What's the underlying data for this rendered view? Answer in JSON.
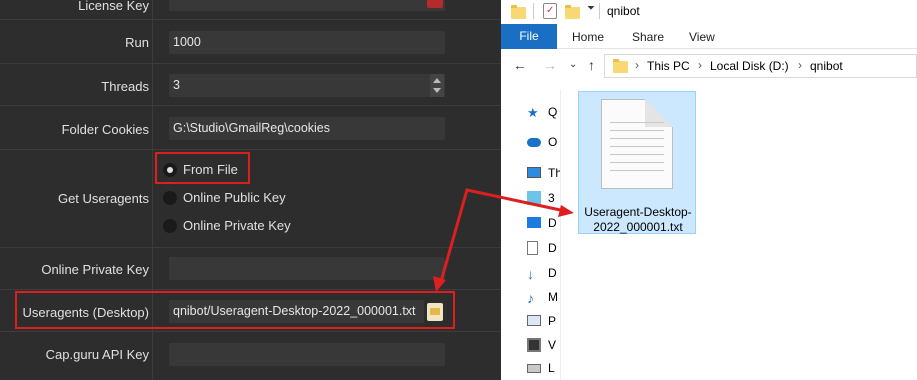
{
  "settings": {
    "license_label": "License Key",
    "run_label": "Run",
    "run_value": "1000",
    "threads_label": "Threads",
    "threads_value": "3",
    "folder_label": "Folder Cookies",
    "folder_value": "G:\\Studio\\GmailReg\\cookies",
    "useragents_label": "Get Useragents",
    "radio_from_file": "From File",
    "radio_public": "Online Public Key",
    "radio_private": "Online Private Key",
    "private_key_label": "Online Private Key",
    "desktop_label": "Useragents (Desktop)",
    "desktop_value": "qnibot/Useragent-Desktop-2022_000001.txt",
    "capguru_label": "Cap.guru API Key",
    "highlight_color": "#dd1f1f"
  },
  "explorer": {
    "title": "qnibot",
    "tabs": [
      "File",
      "Home",
      "Share",
      "View"
    ],
    "breadcrumb": [
      "This PC",
      "Local Disk (D:)",
      "qnibot"
    ],
    "nav_items": [
      "Q",
      "O",
      "Th",
      "3",
      "D",
      "D",
      "D",
      "M",
      "P",
      "V",
      "L"
    ],
    "file": {
      "name_line1": "Useragent-Desktop-",
      "name_line2": "2022_000001.txt"
    }
  },
  "icons": {
    "back": "arrow-left-icon",
    "forward": "arrow-right-icon",
    "recent": "chevron-down-icon",
    "up": "arrow-up-icon",
    "file": "text-document-icon"
  }
}
